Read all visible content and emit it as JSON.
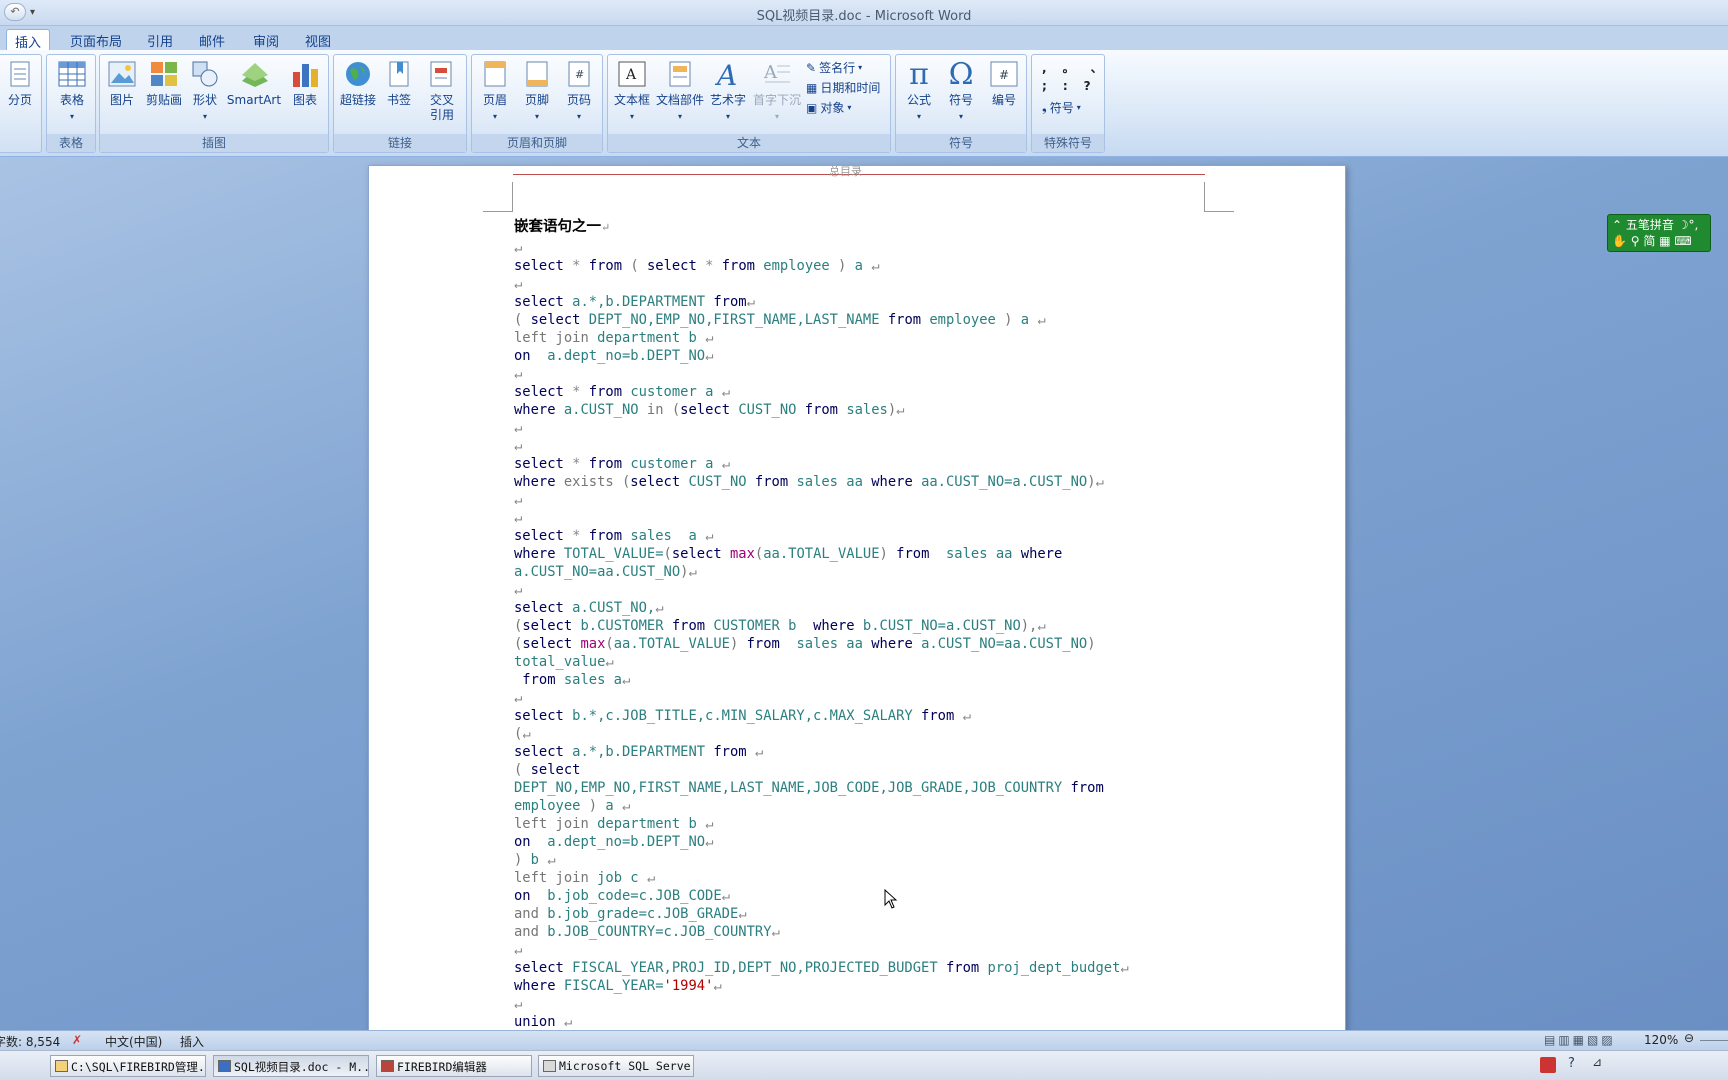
{
  "window": {
    "title": "SQL视频目录.doc - Microsoft Word"
  },
  "tabs": [
    "插入",
    "页面布局",
    "引用",
    "邮件",
    "审阅",
    "视图"
  ],
  "ribbon": {
    "groups": {
      "tables": "表格",
      "illustrations": "插图",
      "links": "链接",
      "header_footer": "页眉和页脚",
      "text": "文本",
      "symbols": "符号",
      "special": "特殊符号"
    },
    "buttons": {
      "page_break": "分页",
      "table": "表格",
      "picture": "图片",
      "clipart": "剪贴画",
      "shapes": "形状",
      "smartart": "SmartArt",
      "chart": "图表",
      "hyperlink": "超链接",
      "bookmark": "书签",
      "crossref_1": "交叉",
      "crossref_2": "引用",
      "header": "页眉",
      "footer": "页脚",
      "page_number": "页码",
      "textbox": "文本框",
      "quick_parts": "文档部件",
      "wordart": "艺术字",
      "dropcap": "首字下沉",
      "signature": "签名行",
      "datetime": "日期和时间",
      "object": "对象",
      "equation": "公式",
      "symbol": "符号",
      "number": "编号",
      "special_symbol": "符号"
    },
    "special_chars": [
      ",",
      "。",
      "、",
      ";",
      ":",
      "?"
    ]
  },
  "document": {
    "header_text": "总目录",
    "heading": "嵌套语句之一",
    "lines": [
      [
        [
          "kw",
          "select "
        ],
        [
          "pm",
          "* "
        ],
        [
          "kw",
          "from "
        ],
        [
          "gr",
          "( "
        ],
        [
          "kw",
          "select "
        ],
        [
          "pm",
          "* "
        ],
        [
          "kw",
          "from "
        ],
        [
          "id",
          "employee "
        ],
        [
          "gr",
          ") "
        ],
        [
          "id",
          "a "
        ],
        [
          "pm",
          "↵"
        ]
      ],
      [
        [
          "pm",
          "↵"
        ]
      ],
      [
        [
          "kw",
          "select "
        ],
        [
          "id",
          "a.*,b.DEPARTMENT "
        ],
        [
          "kw",
          "from"
        ],
        [
          "pm",
          "↵"
        ]
      ],
      [
        [
          "gr",
          "( "
        ],
        [
          "kw",
          "select "
        ],
        [
          "id",
          "DEPT_NO,EMP_NO,FIRST_NAME,LAST_NAME "
        ],
        [
          "kw",
          "from "
        ],
        [
          "id",
          "employee "
        ],
        [
          "gr",
          ") "
        ],
        [
          "id",
          "a "
        ],
        [
          "pm",
          "↵"
        ]
      ],
      [
        [
          "gr",
          "left join "
        ],
        [
          "id",
          "department b "
        ],
        [
          "pm",
          "↵"
        ]
      ],
      [
        [
          "kw",
          "on  "
        ],
        [
          "id",
          "a.dept_no=b.DEPT_NO"
        ],
        [
          "pm",
          "↵"
        ]
      ],
      [
        [
          "pm",
          "↵"
        ]
      ],
      [
        [
          "kw",
          "select "
        ],
        [
          "pm",
          "* "
        ],
        [
          "kw",
          "from "
        ],
        [
          "id",
          "customer a "
        ],
        [
          "pm",
          "↵"
        ]
      ],
      [
        [
          "kw",
          "where "
        ],
        [
          "id",
          "a.CUST_NO "
        ],
        [
          "gr",
          "in ("
        ],
        [
          "kw",
          "select "
        ],
        [
          "id",
          "CUST_NO "
        ],
        [
          "kw",
          "from "
        ],
        [
          "id",
          "sales"
        ],
        [
          "gr",
          ")"
        ],
        [
          "pm",
          "↵"
        ]
      ],
      [
        [
          "pm",
          "↵"
        ]
      ],
      [
        [
          "pm",
          "↵"
        ]
      ],
      [
        [
          "kw",
          "select "
        ],
        [
          "pm",
          "* "
        ],
        [
          "kw",
          "from "
        ],
        [
          "id",
          "customer a "
        ],
        [
          "pm",
          "↵"
        ]
      ],
      [
        [
          "kw",
          "where "
        ],
        [
          "gr",
          "exists ("
        ],
        [
          "kw",
          "select "
        ],
        [
          "id",
          "CUST_NO "
        ],
        [
          "kw",
          "from "
        ],
        [
          "id",
          "sales aa "
        ],
        [
          "kw",
          "where "
        ],
        [
          "id",
          "aa.CUST_NO=a.CUST_NO"
        ],
        [
          "gr",
          ")"
        ],
        [
          "pm",
          "↵"
        ]
      ],
      [
        [
          "pm",
          "↵"
        ]
      ],
      [
        [
          "pm",
          "↵"
        ]
      ],
      [
        [
          "kw",
          "select "
        ],
        [
          "pm",
          "* "
        ],
        [
          "kw",
          "from "
        ],
        [
          "id",
          "sales  a "
        ],
        [
          "pm",
          "↵"
        ]
      ],
      [
        [
          "kw",
          "where "
        ],
        [
          "id",
          "TOTAL_VALUE="
        ],
        [
          "gr",
          "("
        ],
        [
          "kw",
          "select "
        ],
        [
          "fn",
          "max"
        ],
        [
          "gr",
          "("
        ],
        [
          "id",
          "aa.TOTAL_VALUE"
        ],
        [
          "gr",
          ") "
        ],
        [
          "kw",
          "from  "
        ],
        [
          "id",
          "sales aa "
        ],
        [
          "kw",
          "where"
        ]
      ],
      [
        [
          "id",
          "a.CUST_NO=aa.CUST_NO"
        ],
        [
          "gr",
          ")"
        ],
        [
          "pm",
          "↵"
        ]
      ],
      [
        [
          "pm",
          "↵"
        ]
      ],
      [
        [
          "kw",
          "select "
        ],
        [
          "id",
          "a.CUST_NO,"
        ],
        [
          "pm",
          "↵"
        ]
      ],
      [
        [
          "gr",
          "("
        ],
        [
          "kw",
          "select "
        ],
        [
          "id",
          "b.CUSTOMER "
        ],
        [
          "kw",
          "from "
        ],
        [
          "id",
          "CUSTOMER b  "
        ],
        [
          "kw",
          "where "
        ],
        [
          "id",
          "b.CUST_NO=a.CUST_NO"
        ],
        [
          "gr",
          "),"
        ],
        [
          "pm",
          "↵"
        ]
      ],
      [
        [
          "gr",
          "("
        ],
        [
          "kw",
          "select "
        ],
        [
          "fn",
          "max"
        ],
        [
          "gr",
          "("
        ],
        [
          "id",
          "aa.TOTAL_VALUE"
        ],
        [
          "gr",
          ") "
        ],
        [
          "kw",
          "from  "
        ],
        [
          "id",
          "sales aa "
        ],
        [
          "kw",
          "where "
        ],
        [
          "id",
          "a.CUST_NO=aa.CUST_NO"
        ],
        [
          "gr",
          ")"
        ]
      ],
      [
        [
          "id",
          "total_value"
        ],
        [
          "pm",
          "↵"
        ]
      ],
      [
        [
          "kw",
          " from "
        ],
        [
          "id",
          "sales a"
        ],
        [
          "pm",
          "↵"
        ]
      ],
      [
        [
          "pm",
          "↵"
        ]
      ],
      [
        [
          "kw",
          "select "
        ],
        [
          "id",
          "b.*,c.JOB_TITLE,c.MIN_SALARY,c.MAX_SALARY "
        ],
        [
          "kw",
          "from "
        ],
        [
          "pm",
          "↵"
        ]
      ],
      [
        [
          "gr",
          "("
        ],
        [
          "pm",
          "↵"
        ]
      ],
      [
        [
          "kw",
          "select "
        ],
        [
          "id",
          "a.*,b.DEPARTMENT "
        ],
        [
          "kw",
          "from "
        ],
        [
          "pm",
          "↵"
        ]
      ],
      [
        [
          "gr",
          "( "
        ],
        [
          "kw",
          "select"
        ]
      ],
      [
        [
          "id",
          "DEPT_NO,EMP_NO,FIRST_NAME,LAST_NAME,JOB_CODE,JOB_GRADE,JOB_COUNTRY "
        ],
        [
          "kw",
          "from"
        ]
      ],
      [
        [
          "id",
          "employee "
        ],
        [
          "gr",
          ") "
        ],
        [
          "id",
          "a "
        ],
        [
          "pm",
          "↵"
        ]
      ],
      [
        [
          "gr",
          "left join "
        ],
        [
          "id",
          "department b "
        ],
        [
          "pm",
          "↵"
        ]
      ],
      [
        [
          "kw",
          "on  "
        ],
        [
          "id",
          "a.dept_no=b.DEPT_NO"
        ],
        [
          "pm",
          "↵"
        ]
      ],
      [
        [
          "gr",
          ") "
        ],
        [
          "id",
          "b "
        ],
        [
          "pm",
          "↵"
        ]
      ],
      [
        [
          "gr",
          "left join "
        ],
        [
          "id",
          "job c "
        ],
        [
          "pm",
          "↵"
        ]
      ],
      [
        [
          "kw",
          "on  "
        ],
        [
          "id",
          "b.job_code=c.JOB_CODE"
        ],
        [
          "pm",
          "↵"
        ]
      ],
      [
        [
          "gr",
          "and "
        ],
        [
          "id",
          "b.job_grade=c.JOB_GRADE"
        ],
        [
          "pm",
          "↵"
        ]
      ],
      [
        [
          "gr",
          "and "
        ],
        [
          "id",
          "b.JOB_COUNTRY=c.JOB_COUNTRY"
        ],
        [
          "pm",
          "↵"
        ]
      ],
      [
        [
          "pm",
          "↵"
        ]
      ],
      [
        [
          "kw",
          "select "
        ],
        [
          "id",
          "FISCAL_YEAR,PROJ_ID,DEPT_NO,PROJECTED_BUDGET "
        ],
        [
          "kw",
          "from "
        ],
        [
          "id",
          "proj_dept_budget"
        ],
        [
          "pm",
          "↵"
        ]
      ],
      [
        [
          "kw",
          "where "
        ],
        [
          "id",
          "FISCAL_YEAR="
        ],
        [
          "str",
          "'1994'"
        ],
        [
          "pm",
          "↵"
        ]
      ],
      [
        [
          "pm",
          "↵"
        ]
      ],
      [
        [
          "kw",
          "union "
        ],
        [
          "pm",
          "↵"
        ]
      ]
    ]
  },
  "ime": {
    "name": "五笔拼音",
    "mode": "简"
  },
  "status": {
    "word_count": "字数: 8,554",
    "language": "中文(中国)",
    "mode": "插入",
    "zoom": "120%"
  },
  "taskbar": [
    "C:\\SQL\\FIREBIRD管理...",
    "SQL视频目录.doc - M...",
    "FIREBIRD编辑器",
    "Microsoft SQL Serve..."
  ]
}
